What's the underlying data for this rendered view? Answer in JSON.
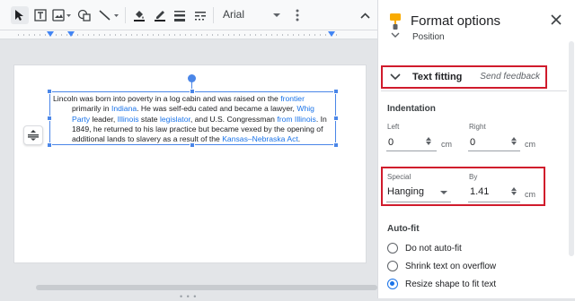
{
  "toolbar": {
    "font": "Arial",
    "icons": [
      "select-cursor-icon",
      "textbox-icon",
      "image-icon",
      "shape-icon",
      "line-icon",
      "fill-color-icon",
      "border-color-icon",
      "border-weight-icon",
      "border-dash-icon",
      "more-icon"
    ]
  },
  "document": {
    "paragraph": {
      "p1": "Lincoln was born into poverty in a log cabin and was raised on the ",
      "link_frontier": "frontier",
      "p2": " primarily in ",
      "link_indiana": "Indiana",
      "p3": ". He was self-edu cated and became a lawyer, ",
      "link_whig": "Whig Party",
      "p4": " leader, ",
      "link_illinois_leg": "Illinois",
      "p5": " state ",
      "link_legislator": "legislator",
      "p6": ", and U.S. Congressman ",
      "link_from_illinois": "from Illinois",
      "p7": ". In 1849, he returned to his law practice but became vexed by the opening of additional lands to slavery as a result of the ",
      "link_kansas": "Kansas–Nebraska Act",
      "p8": "."
    }
  },
  "panel": {
    "title": "Format options",
    "position_label": "Position",
    "text_fitting": {
      "title": "Text fitting",
      "feedback": "Send feedback"
    },
    "indentation": {
      "title": "Indentation",
      "left_label": "Left",
      "left_value": "0",
      "left_unit": "cm",
      "right_label": "Right",
      "right_value": "0",
      "right_unit": "cm"
    },
    "special": {
      "special_label": "Special",
      "special_value": "Hanging",
      "by_label": "By",
      "by_value": "1.41",
      "by_unit": "cm"
    },
    "autofit": {
      "title": "Auto-fit",
      "options": [
        "Do not auto-fit",
        "Shrink text on overflow",
        "Resize shape to fit text"
      ],
      "selected_index": 2
    }
  },
  "colors": {
    "accent": "#1a73e8",
    "highlight_border": "#d01b2c",
    "selection": "#4a86e8",
    "panel_icon": "#f9ab00"
  }
}
